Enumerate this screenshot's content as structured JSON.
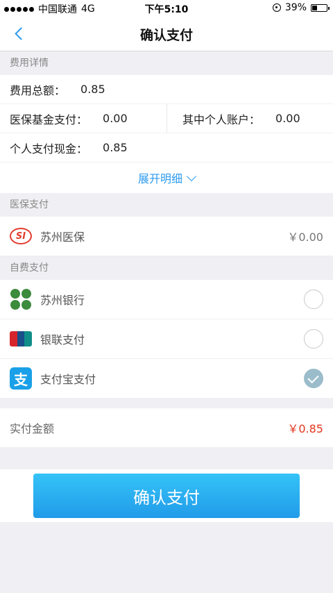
{
  "status_bar": {
    "carrier": "中国联通",
    "network": "4G",
    "time": "下午5:10",
    "battery": "39%",
    "battery_level": 0.39
  },
  "nav": {
    "title": "确认支付"
  },
  "fee_details": {
    "header": "费用详情",
    "total_label": "费用总额：",
    "total_value": "0.85",
    "fund_label": "医保基金支付：",
    "fund_value": "0.00",
    "personal_account_label": "其中个人账户：",
    "personal_account_value": "0.00",
    "cash_label": "个人支付现金：",
    "cash_value": "0.85",
    "expand_label": "展开明细"
  },
  "insurance": {
    "header": "医保支付",
    "item_name": "苏州医保",
    "item_amount": "￥0.00",
    "icon_text": "SI"
  },
  "self_pay": {
    "header": "自费支付",
    "options": [
      {
        "name": "苏州银行",
        "selected": false,
        "icon": "suzhou-bank-icon"
      },
      {
        "name": "银联支付",
        "selected": false,
        "icon": "unionpay-icon"
      },
      {
        "name": "支付宝支付",
        "selected": true,
        "icon": "alipay-icon"
      }
    ]
  },
  "payment": {
    "label": "实付金额",
    "value": "￥0.85"
  },
  "confirm_button": "确认支付"
}
